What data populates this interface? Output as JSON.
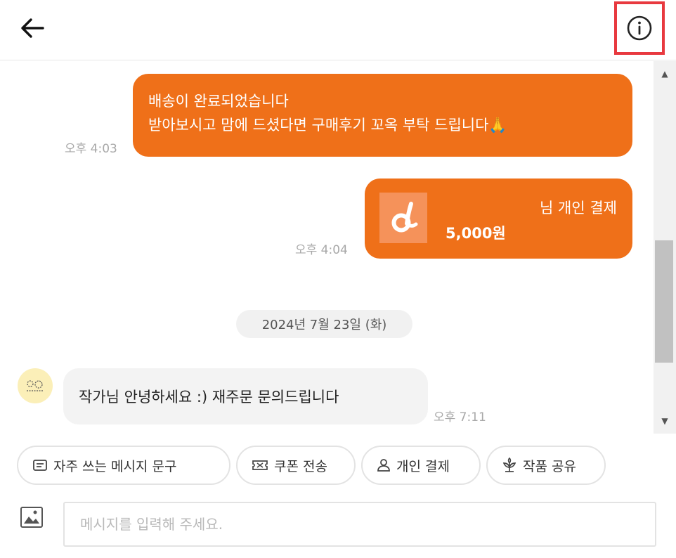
{
  "header": {
    "back_icon": "arrow-left-icon",
    "info_icon": "info-circle-icon"
  },
  "messages": [
    {
      "direction": "outgoing",
      "lines": [
        "배송이 완료되었습니다",
        "받아보시고 맘에 드셨다면 구매후기 꼬옥 부탁 드립니다🙏"
      ],
      "time": "오후 4:03"
    },
    {
      "direction": "outgoing",
      "type": "payment",
      "title": "님 개인 결제",
      "amount": "5,000원",
      "logo_icon": "payment-logo-icon",
      "time": "오후 4:04"
    },
    {
      "direction": "incoming",
      "avatar_icon": "user-avatar-icon",
      "text": "작가님 안녕하세요 :) 재주문 문의드립니다",
      "time": "오후 7:11"
    }
  ],
  "date_divider": "2024년 7월 23일 (화)",
  "quick_actions": [
    {
      "label": "자주 쓰는 메시지 문구",
      "icon": "message-template-icon"
    },
    {
      "label": "쿠폰 전송",
      "icon": "coupon-icon"
    },
    {
      "label": "개인 결제",
      "icon": "person-icon"
    },
    {
      "label": "작품 공유",
      "icon": "plant-icon"
    }
  ],
  "composer": {
    "placeholder": "메시지를 입력해 주세요.",
    "value": "",
    "attach_icon": "image-icon"
  },
  "colors": {
    "accent": "#ef7019",
    "highlight_border": "#e8393f",
    "incoming_bubble": "#f3f3f3"
  }
}
